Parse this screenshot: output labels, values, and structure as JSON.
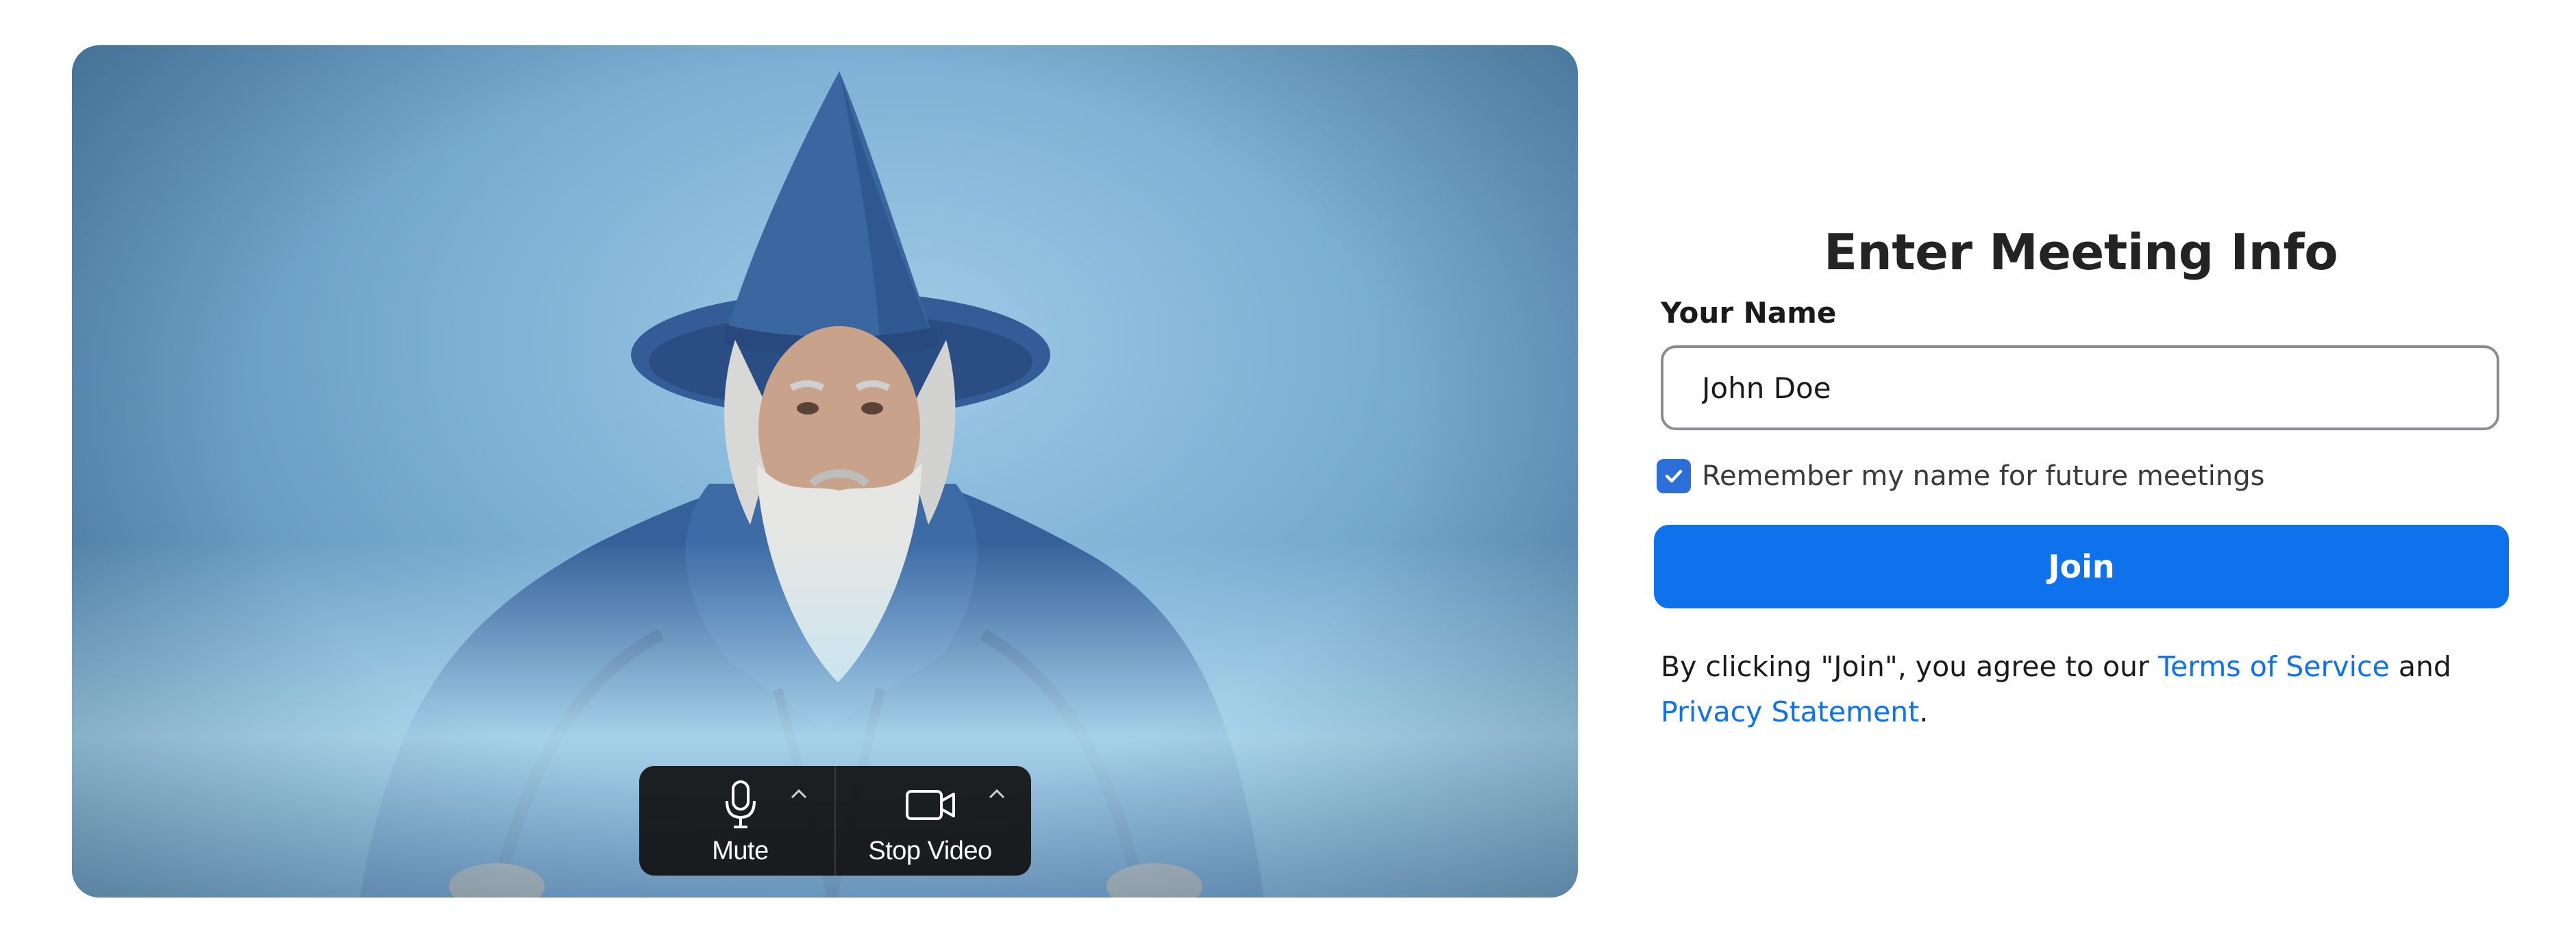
{
  "video": {
    "mute_label": "Mute",
    "stop_video_label": "Stop Video",
    "icons": {
      "mute": "microphone-icon",
      "video": "video-camera-icon",
      "audio_options": "chevron-up-icon",
      "video_options": "chevron-up-icon"
    }
  },
  "form": {
    "title": "Enter Meeting Info",
    "name_label": "Your Name",
    "name_value": "John Doe",
    "remember_label": "Remember my name for future meetings",
    "remember_checked": true,
    "join_label": "Join",
    "terms": {
      "prefix": "By clicking \"Join\", you agree to our ",
      "tos_link": "Terms of Service",
      "middle": " and",
      "privacy_link": "Privacy Statement",
      "suffix": "."
    }
  },
  "colors": {
    "accent": "#0e72ed",
    "checkbox": "#2d6fd8",
    "control_bar": "#121212",
    "input_border": "#8c8c92",
    "title_text": "#232323"
  }
}
